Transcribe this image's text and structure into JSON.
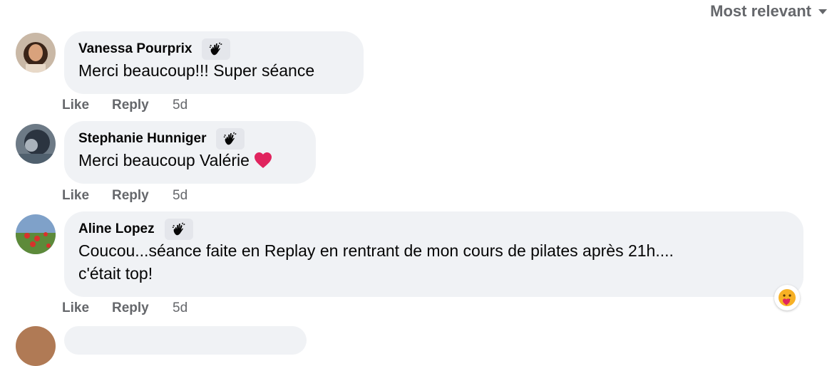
{
  "sort": {
    "label": "Most relevant"
  },
  "comments": [
    {
      "name": "Vanessa Pourprix",
      "text": "Merci beaucoup!!! Super séance",
      "like": "Like",
      "reply": "Reply",
      "time": "5d"
    },
    {
      "name": "Stephanie Hunniger",
      "text": "Merci beaucoup Valérie",
      "like": "Like",
      "reply": "Reply",
      "time": "5d"
    },
    {
      "name": "Aline Lopez",
      "text_line1": "Coucou...séance faite en Replay en rentrant de mon cours de pilates après 21h....",
      "text_line2": "c'était top!",
      "like": "Like",
      "reply": "Reply",
      "time": "5d"
    }
  ],
  "icons": {
    "badge": "waving-hand-icon",
    "heart": "red-heart-icon",
    "reaction": "care-reaction-icon",
    "sort": "caret-down-icon"
  },
  "colors": {
    "bubble": "#f0f2f5",
    "secondary_text": "#65676b",
    "heart": "#e0245e"
  }
}
